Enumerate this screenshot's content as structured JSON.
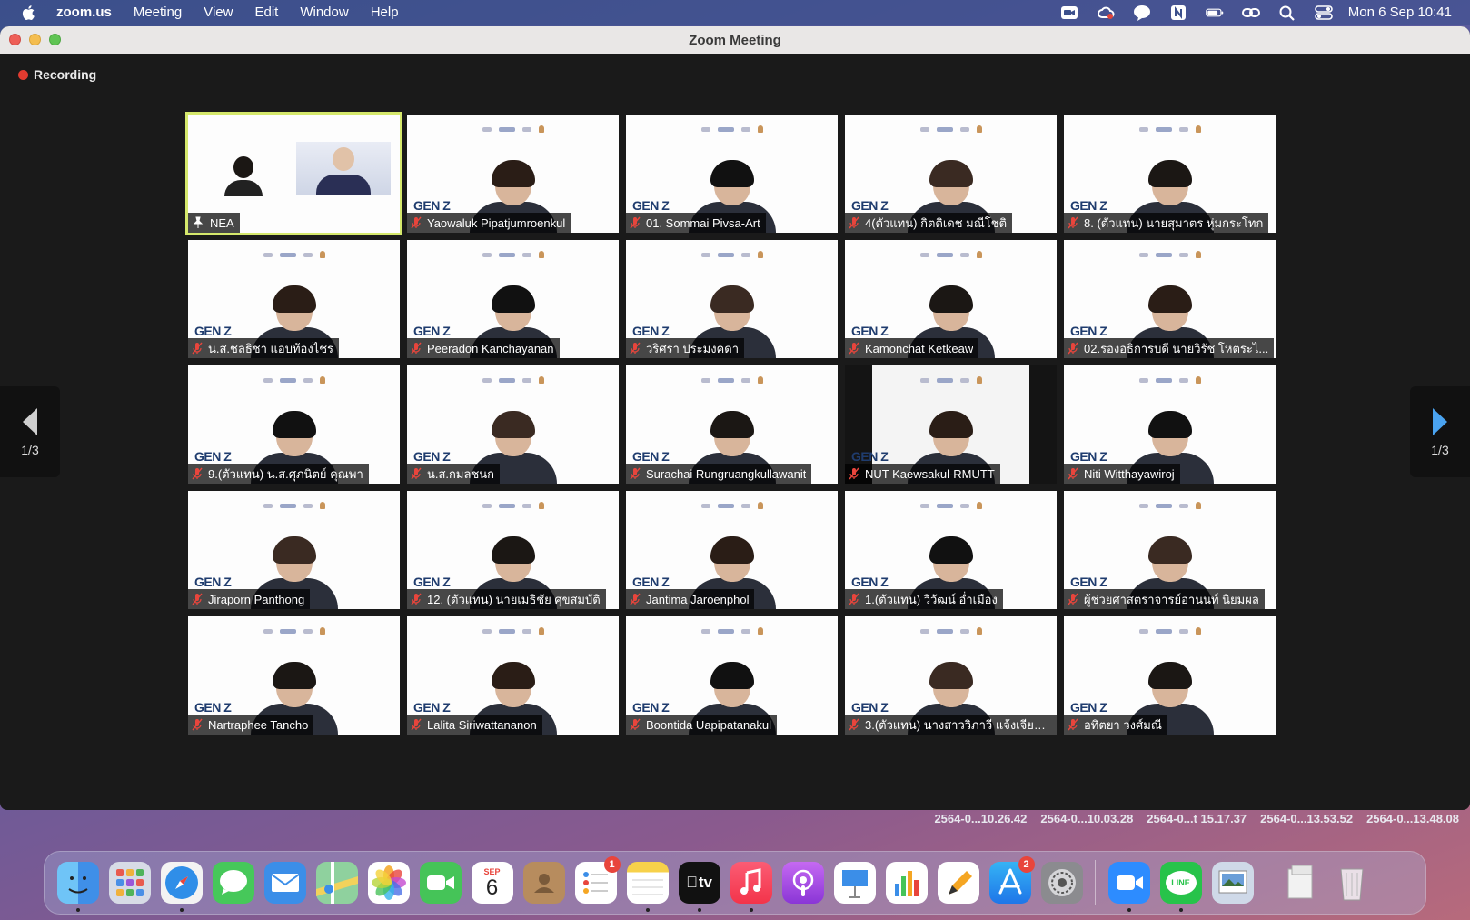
{
  "menubar": {
    "app": "zoom.us",
    "items": [
      "Meeting",
      "View",
      "Edit",
      "Window",
      "Help"
    ],
    "clock": "Mon 6 Sep  10:41",
    "status_icons": [
      "zoom-video-icon",
      "creative-cloud-icon",
      "line-chat-icon",
      "notion-icon",
      "battery-icon",
      "link-icon",
      "spotlight-search-icon",
      "control-center-icon"
    ]
  },
  "window": {
    "title": "Zoom Meeting",
    "recording_label": "Recording",
    "pager_left": "1/3",
    "pager_right": "1/3"
  },
  "participants": [
    {
      "name": "NEA",
      "pinned": true,
      "active": true
    },
    {
      "name": "Yaowaluk Pipatjumroenkul"
    },
    {
      "name": "01. Sommai Pivsa-Art"
    },
    {
      "name": "4(ตัวแทน) กิตติเดช มณีโชติ"
    },
    {
      "name": "8. (ตัวแทน) นายสุมาตร หุ่มกระโทก"
    },
    {
      "name": "น.ส.ชลธิชา แอบท้องไชร"
    },
    {
      "name": "Peeradon Kanchayanan"
    },
    {
      "name": "วริศรา ประมงคดา"
    },
    {
      "name": "Kamonchat Ketkeaw"
    },
    {
      "name": "02.รองอธิการบดี นายวิรัช โหตระไ..."
    },
    {
      "name": "9.(ตัวแทน) น.ส.ศุภนิตย์ คุณพา"
    },
    {
      "name": "น.ส.กมลชนก"
    },
    {
      "name": "Surachai Rungruangkullawanit"
    },
    {
      "name": "NUT Kaewsakul-RMUTT",
      "darkbg": true
    },
    {
      "name": "Niti Witthayawiroj"
    },
    {
      "name": "Jiraporn Panthong"
    },
    {
      "name": "12. (ตัวแทน) นายเมธิชัย ศุขสมบัติ"
    },
    {
      "name": "Jantima Jaroenphol"
    },
    {
      "name": "1.(ตัวแทน) วิวัฒน์ อ่ำเมือง"
    },
    {
      "name": "ผู้ช่วยศาสตราจารย์อานนท์ นิยมผล"
    },
    {
      "name": "Nartraphee Tancho"
    },
    {
      "name": "Lalita Siriwattananon"
    },
    {
      "name": "Boontida Uapipatanakul"
    },
    {
      "name": "3.(ตัวแทน) นางสาววิภาวี แจ้งเจียน..."
    },
    {
      "name": "อทิตยา วงศ์มณี"
    }
  ],
  "tile_branding": {
    "genz_label": "GEN Z"
  },
  "desktop_files": [
    "2564-0...10.26.42",
    "2564-0...10.03.28",
    "2564-0...t 15.17.37",
    "2564-0...13.53.52",
    "2564-0...13.48.08"
  ],
  "dock": {
    "calendar_month": "SEP",
    "calendar_day": "6",
    "appletv_label": "tv",
    "line_label": "LINE",
    "reminders_badge": "1",
    "appstore_badge": "2"
  }
}
